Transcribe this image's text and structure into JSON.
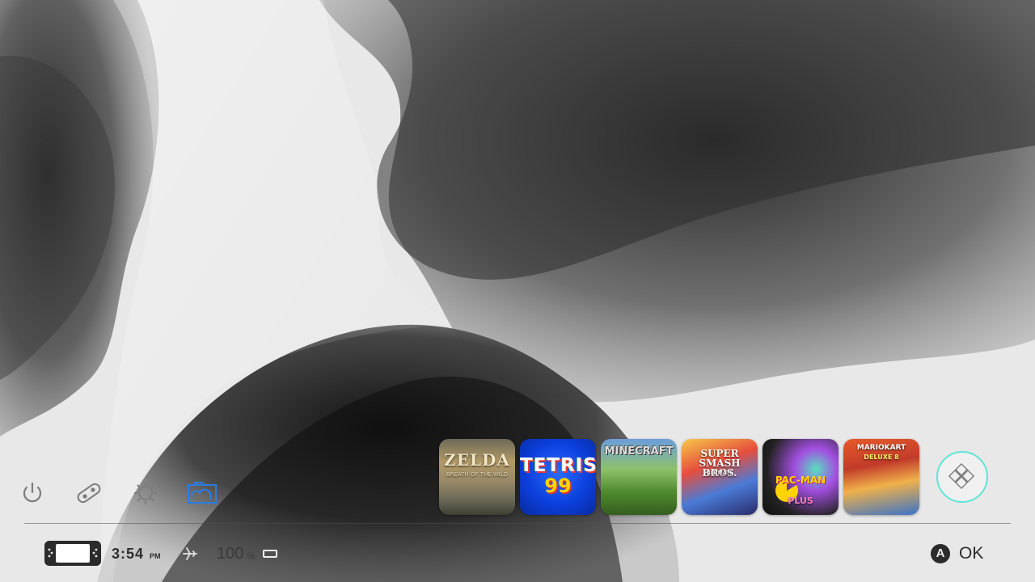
{
  "games": [
    {
      "id": "zelda",
      "title": "ZELDA",
      "subtitle": "BREATH OF THE WILD"
    },
    {
      "id": "tetris",
      "title": "TETRIS",
      "subtitle": "99"
    },
    {
      "id": "minecraft",
      "title": "MINECRAFT",
      "subtitle": ""
    },
    {
      "id": "smash",
      "title": "SUPER SMASH BROS.",
      "subtitle": "ULTIMATE"
    },
    {
      "id": "pacman",
      "title": "PAC-MAN",
      "subtitle": "PLUS"
    },
    {
      "id": "mariokart",
      "title": "MARIOKART",
      "subtitle": "DELUXE 8"
    }
  ],
  "dock": {
    "icons": [
      "power-icon",
      "controller-icon",
      "settings-gear-icon",
      "album-icon"
    ],
    "active_icon": "album-icon",
    "active_color": "#2a7de1"
  },
  "status_bar": {
    "time": "3:54",
    "ampm": "PM",
    "battery_percent": "100",
    "battery_unit": "%",
    "airplane_mode_icon": "airplane-icon"
  },
  "hint": {
    "button": "A",
    "label": "OK"
  },
  "colors": {
    "accent_ring": "#5ee6d4",
    "background": "#e8e8e8"
  }
}
